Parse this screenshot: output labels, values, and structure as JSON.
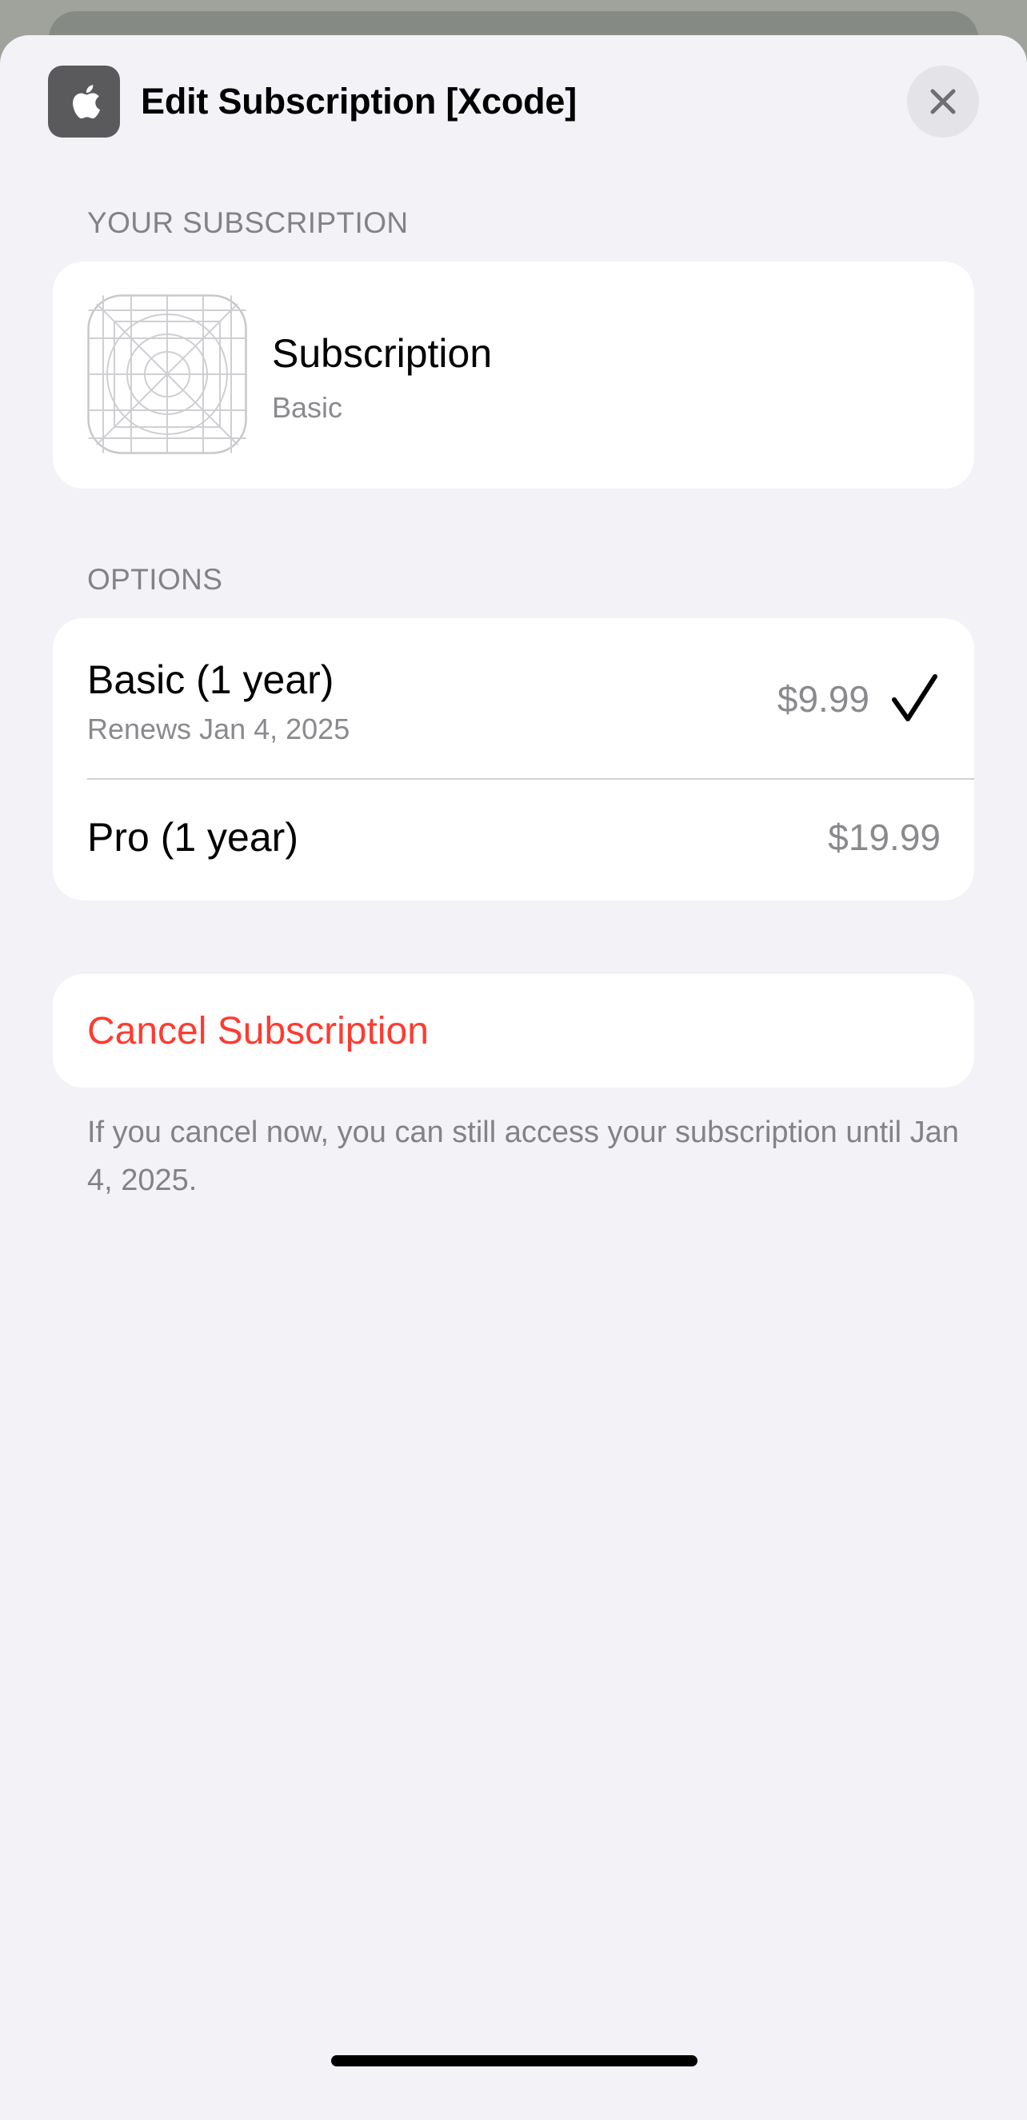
{
  "header": {
    "title": "Edit Subscription [Xcode]",
    "app_icon": "apple-logo-icon",
    "close_icon": "close-icon"
  },
  "your_subscription": {
    "section_label": "YOUR SUBSCRIPTION",
    "icon": "app-icon-placeholder",
    "name": "Subscription",
    "plan": "Basic"
  },
  "options": {
    "section_label": "OPTIONS",
    "items": [
      {
        "title": "Basic (1 year)",
        "subtitle": "Renews Jan 4, 2025",
        "price": "$9.99",
        "selected": true
      },
      {
        "title": "Pro (1 year)",
        "price": "$19.99",
        "selected": false
      }
    ]
  },
  "cancel": {
    "label": "Cancel Subscription",
    "note": "If you cancel now, you can still access your subscription until Jan 4, 2025."
  },
  "colors": {
    "destructive": "#ff3b30",
    "background": "#f2f2f7",
    "secondary_text": "#8a8a8e"
  }
}
